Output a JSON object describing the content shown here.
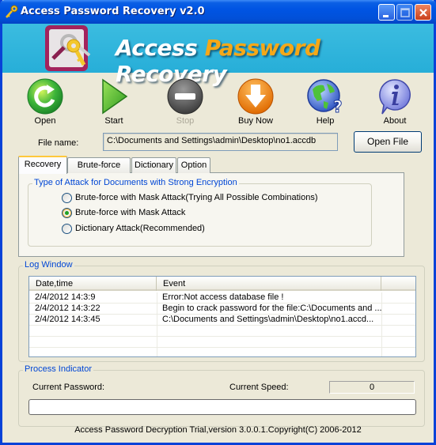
{
  "window": {
    "title": "Access Password Recovery v2.0",
    "controls": [
      "minimize",
      "maximize",
      "close"
    ]
  },
  "banner": {
    "title_part1": "Access ",
    "title_accent": "Password",
    "title_part2": " Recovery",
    "accent_color": "#f5a818"
  },
  "toolbar": {
    "items": [
      {
        "label": "Open",
        "icon": "open-refresh-icon",
        "enabled": true
      },
      {
        "label": "Start",
        "icon": "play-icon",
        "enabled": true
      },
      {
        "label": "Stop",
        "icon": "stop-icon",
        "enabled": false
      },
      {
        "label": "Buy Now",
        "icon": "download-arrow-icon",
        "enabled": true
      },
      {
        "label": "Help",
        "icon": "globe-help-icon",
        "enabled": true
      },
      {
        "label": "About",
        "icon": "info-icon",
        "enabled": true
      }
    ]
  },
  "file": {
    "label": "File name:",
    "value": "C:\\Documents and Settings\\admin\\Desktop\\no1.accdb",
    "open_button": "Open File"
  },
  "tabs": {
    "items": [
      "Recovery",
      "Brute-force",
      "Dictionary",
      "Option"
    ],
    "active": "Recovery"
  },
  "attack": {
    "group_title": "Type of Attack for Documents with Strong Encryption",
    "options": [
      {
        "label": "Brute-force with Mask Attack(Trying All Possible Combinations)",
        "checked": false
      },
      {
        "label": "Brute-force with Mask Attack",
        "checked": true
      },
      {
        "label": "Dictionary Attack(Recommended)",
        "checked": false
      }
    ]
  },
  "log": {
    "group_title": "Log Window",
    "columns": [
      "Date,time",
      "Event"
    ],
    "rows": [
      {
        "datetime": "2/4/2012 14:3:9",
        "event": "Error:Not access database file !"
      },
      {
        "datetime": "2/4/2012 14:3:22",
        "event": "Begin to crack password for the file:C:\\Documents and ..."
      },
      {
        "datetime": "2/4/2012 14:3:45",
        "event": "C:\\Documents and Settings\\admin\\Desktop\\no1.accd..."
      }
    ]
  },
  "process": {
    "group_title": "Process Indicator",
    "current_password_label": "Current Password:",
    "current_password_value": "",
    "current_speed_label": "Current Speed:",
    "current_speed_value": "0",
    "progress_percent": 0
  },
  "footer": {
    "text": "Access Password Decryption Trial,version 3.0.0.1.Copyright(C) 2006-2012"
  }
}
